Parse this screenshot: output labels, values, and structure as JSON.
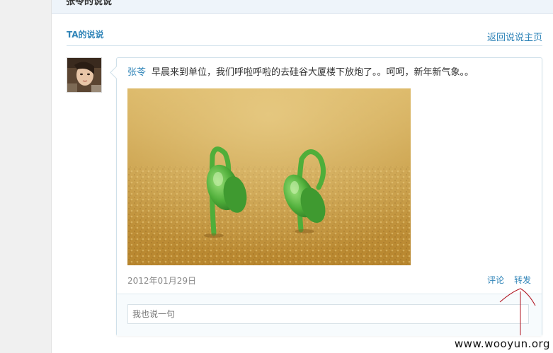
{
  "header": {
    "title": "张苓的说说"
  },
  "section": {
    "title": "TA的说说",
    "back_link": "返回说说主页"
  },
  "post": {
    "author": "张苓",
    "text": "早晨来到单位，我们呼啦呼啦的去硅谷大厦楼下放炮了。。呵呵，新年新气象。。",
    "date": "2012年01月29日",
    "comment_label": "评论",
    "forward_label": "转发",
    "reply_placeholder": "我也说一句"
  },
  "watermark": "www.wooyun.org",
  "colors": {
    "link": "#2f84b8",
    "annotation": "#b0131f"
  }
}
